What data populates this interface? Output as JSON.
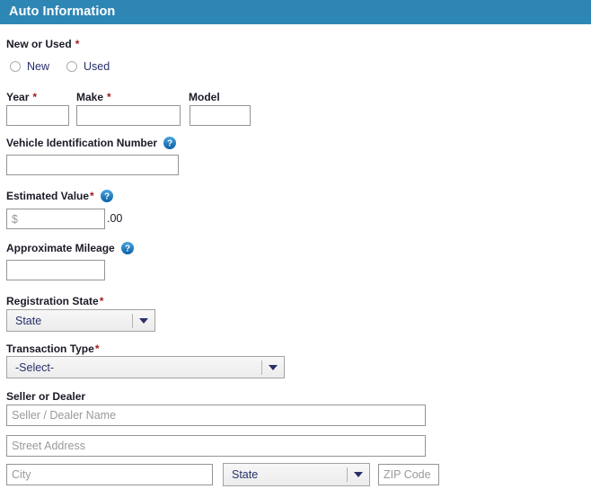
{
  "header": {
    "title": "Auto Information",
    "bar_color": "#2e86b5",
    "title_color": "#ffffff"
  },
  "colors": {
    "accent": "#2e86b5",
    "required_asterisk": "#9e1b1b",
    "select_text": "#27306b",
    "label_text": "#1b1b28",
    "placeholder": "#9a9a9a",
    "input_border": "#949494",
    "help_icon": "#1577bd"
  },
  "form": {
    "new_or_used": {
      "label": "New or Used",
      "required": "*",
      "options": [
        {
          "label": "New",
          "value": "new",
          "selected": false
        },
        {
          "label": "Used",
          "value": "used",
          "selected": false
        }
      ]
    },
    "year": {
      "label": "Year",
      "required": "*",
      "value": "",
      "placeholder": ""
    },
    "make": {
      "label": "Make",
      "required": "*",
      "value": "",
      "placeholder": ""
    },
    "model": {
      "label": "Model",
      "required": "",
      "value": "",
      "placeholder": ""
    },
    "vin": {
      "label": "Vehicle Identification Number",
      "required": "",
      "help_icon": "help-question-icon",
      "value": "",
      "placeholder": ""
    },
    "estimated_value": {
      "label": "Estimated Value",
      "required": "*",
      "help_icon": "help-question-icon",
      "value": "",
      "placeholder": "$",
      "suffix": ".00"
    },
    "approximate_mileage": {
      "label": "Approximate Mileage",
      "required": "",
      "help_icon": "help-question-icon",
      "value": "",
      "placeholder": ""
    },
    "registration_state": {
      "label": "Registration State",
      "required": "*",
      "selected": "State"
    },
    "transaction_type": {
      "label": "Transaction Type",
      "required": "*",
      "selected": "-Select-"
    },
    "seller_or_dealer": {
      "label": "Seller or Dealer",
      "required": "",
      "name": {
        "value": "",
        "placeholder": "Seller / Dealer Name"
      },
      "street": {
        "value": "",
        "placeholder": "Street Address"
      },
      "city": {
        "value": "",
        "placeholder": "City"
      },
      "state": {
        "selected": "State"
      },
      "zip": {
        "value": "",
        "placeholder": "ZIP Code"
      }
    }
  }
}
